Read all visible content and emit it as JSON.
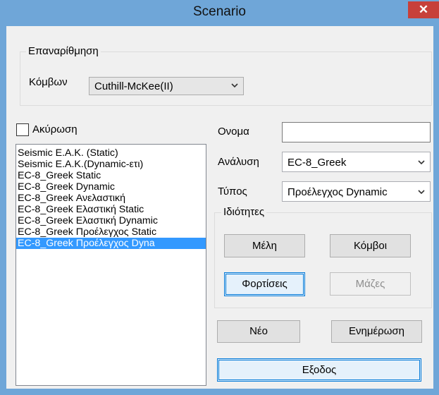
{
  "window": {
    "title": "Scenario",
    "close_label": "✕"
  },
  "numbering": {
    "group_label": "Επαναρίθμηση",
    "nodes_label": "Κόμβων",
    "nodes_value": "Cuthill-McKee(II)"
  },
  "cancel": {
    "label": "Ακύρωση",
    "checked": false
  },
  "scenarios": [
    {
      "label": "Seismic Ε.Α.Κ. (Static)",
      "selected": false
    },
    {
      "label": "Seismic Ε.Α.Κ.(Dynamic-ετι)",
      "selected": false
    },
    {
      "label": "EC-8_Greek Static",
      "selected": false
    },
    {
      "label": "EC-8_Greek Dynamic",
      "selected": false
    },
    {
      "label": "EC-8_Greek Ανελαστική",
      "selected": false
    },
    {
      "label": "EC-8_Greek Ελαστική Static",
      "selected": false
    },
    {
      "label": "EC-8_Greek Ελαστική Dynamic",
      "selected": false
    },
    {
      "label": "EC-8_Greek Προέλεγχος Static",
      "selected": false
    },
    {
      "label": "EC-8_Greek Προέλεγχος Dyna",
      "selected": true
    }
  ],
  "form": {
    "name_label": "Ονομα",
    "name_value": "",
    "analysis_label": "Ανάλυση",
    "analysis_value": "EC-8_Greek",
    "type_label": "Τύπος",
    "type_value": "Προέλεγχος Dynamic"
  },
  "properties": {
    "group_label": "Ιδιότητες",
    "members_button": "Μέλη",
    "nodes_button": "Κόμβοι",
    "loads_button": "Φορτίσεις",
    "masses_button": "Μάζες"
  },
  "actions": {
    "new_button": "Νέο",
    "update_button": "Ενημέρωση",
    "exit_button": "Εξοδος"
  },
  "icons": {
    "dropdown": "chevron-down-icon",
    "close": "close-icon"
  },
  "colors": {
    "selection": "#3399ff",
    "titlebar": "#6fa6d8",
    "close": "#c7403a"
  }
}
